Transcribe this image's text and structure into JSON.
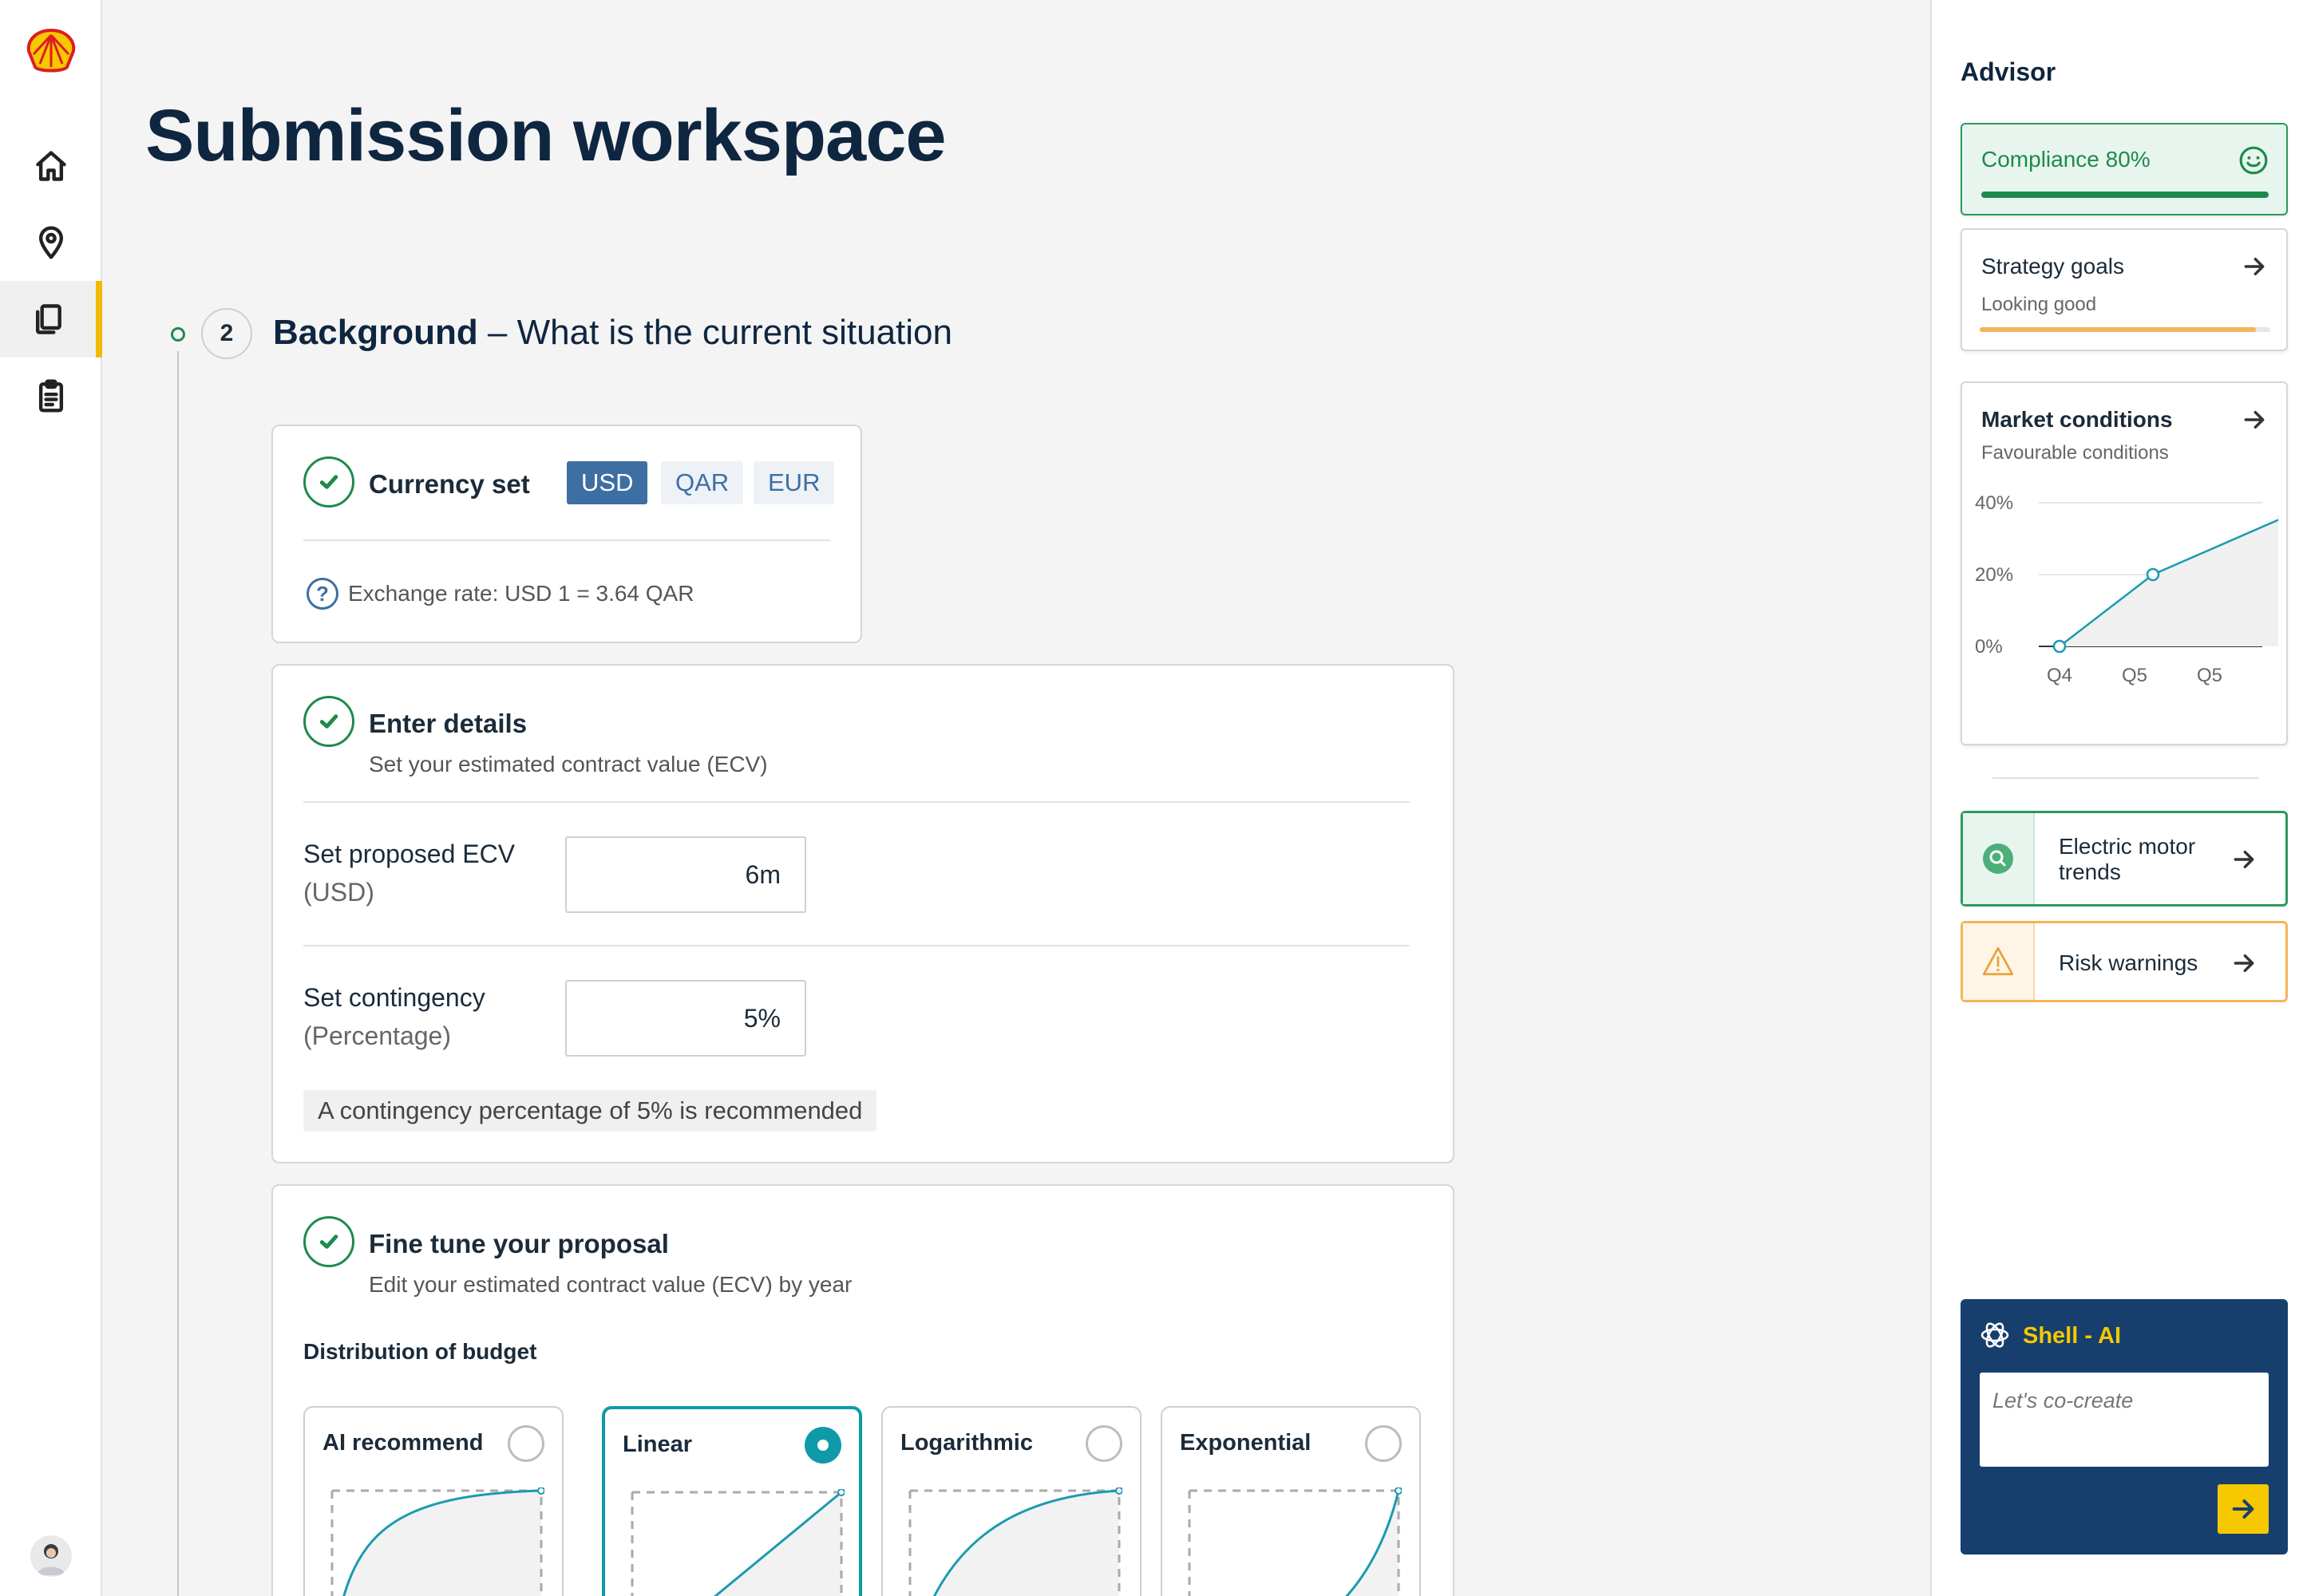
{
  "page": {
    "title": "Submission workspace"
  },
  "step": {
    "number": "2",
    "title_bold": "Background",
    "title_rest": " – What is the current situation"
  },
  "currency": {
    "title": "Currency set",
    "options": [
      "USD",
      "QAR",
      "EUR"
    ],
    "selected": "USD",
    "exchange_rate": "Exchange rate: USD 1 = 3.64 QAR"
  },
  "details": {
    "title": "Enter details",
    "subtitle": "Set your estimated contract value (ECV)",
    "ecv_label": "Set proposed ECV",
    "ecv_unit": "(USD)",
    "ecv_value": "6m",
    "contingency_label": "Set contingency",
    "contingency_unit": "(Percentage)",
    "contingency_value": "5%",
    "hint": "A contingency percentage of 5% is recommended"
  },
  "fine_tune": {
    "title": "Fine tune your proposal",
    "subtitle": "Edit your estimated contract value (ECV) by year",
    "distribution_label": "Distribution of budget",
    "options": [
      "AI recommend",
      "Linear",
      "Logarithmic",
      "Exponential"
    ],
    "selected": "Linear"
  },
  "advisor": {
    "title": "Advisor",
    "compliance": {
      "label": "Compliance 80%",
      "progress": 0.8
    },
    "strategy": {
      "title": "Strategy goals",
      "status": "Looking good",
      "progress": 0.95
    },
    "market": {
      "title": "Market conditions",
      "status": "Favourable conditions"
    },
    "insights": [
      {
        "label": "Electric motor trends",
        "icon": "search-icon"
      },
      {
        "label": "Risk warnings",
        "icon": "warning-icon"
      }
    ],
    "ai": {
      "title": "Shell - AI",
      "placeholder": "Let's co-create"
    }
  },
  "chart_data": {
    "type": "line",
    "categories": [
      "Q4",
      "Q5",
      "Q5"
    ],
    "x_ticks": [
      "Q4",
      "Q5",
      "Q5"
    ],
    "y_ticks": [
      "0%",
      "20%",
      "40%"
    ],
    "ylim": [
      0,
      40
    ],
    "series": [
      {
        "values": [
          0,
          20,
          36
        ]
      }
    ],
    "grid": true,
    "color": "#1a9bb0"
  },
  "colors": {
    "accent": "#0f9aa8",
    "success": "#1e8a4c",
    "brand": "#f5c800",
    "warning": "#f5b45a",
    "ai_bg": "#173f6e"
  }
}
